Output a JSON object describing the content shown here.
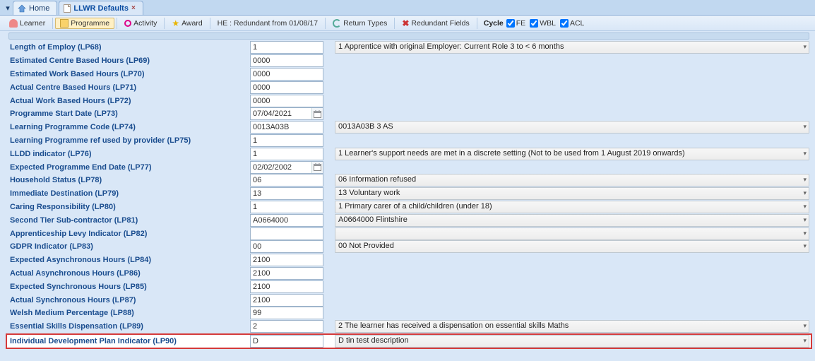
{
  "tabs": {
    "home": "Home",
    "llwr": "LLWR Defaults"
  },
  "toolbar": {
    "learner": "Learner",
    "programme": "Programme",
    "activity": "Activity",
    "award": "Award",
    "he": "HE : Redundant from 01/08/17",
    "return_types": "Return Types",
    "redundant": "Redundant Fields",
    "cycle": "Cycle",
    "fe": "FE",
    "wbl": "WBL",
    "acl": "ACL"
  },
  "rows": [
    {
      "label": "Length of Employ (LP68)",
      "value": "1",
      "desc": "1  Apprentice with original Employer: Current Role 3 to < 6 months",
      "dd": true
    },
    {
      "label": "Estimated Centre Based Hours (LP69)",
      "value": "0000"
    },
    {
      "label": "Estimated Work Based Hours (LP70)",
      "value": "0000"
    },
    {
      "label": "Actual Centre Based Hours (LP71)",
      "value": "0000"
    },
    {
      "label": "Actual Work Based Hours (LP72)",
      "value": "0000"
    },
    {
      "label": "Programme Start Date (LP73)",
      "value": "07/04/2021",
      "cal": true
    },
    {
      "label": "Learning Programme Code (LP74)",
      "value": "0013A03B",
      "desc": "0013A03B  3 AS",
      "dd": true
    },
    {
      "label": "Learning Programme ref used by provider (LP75)",
      "value": "1"
    },
    {
      "label": "LLDD indicator (LP76)",
      "value": "1",
      "desc": "1  Learner's support needs are met in a discrete setting (Not to be used from 1 August 2019 onwards)",
      "dd": true
    },
    {
      "label": "Expected Programme End Date (LP77)",
      "value": "02/02/2002",
      "cal": true
    },
    {
      "label": "Household Status (LP78)",
      "value": "06",
      "desc": "06  Information refused",
      "dd": true
    },
    {
      "label": "Immediate Destination (LP79)",
      "value": "13",
      "desc": "13  Voluntary work",
      "dd": true
    },
    {
      "label": "Caring Responsibility (LP80)",
      "value": "1",
      "desc": "1  Primary carer of a child/children (under 18)",
      "dd": true
    },
    {
      "label": "Second Tier Sub-contractor (LP81)",
      "value": "A0664000",
      "desc": "A0664000  Flintshire",
      "dd": true
    },
    {
      "label": "Apprenticeship Levy Indicator (LP82)",
      "value": "",
      "desc": "",
      "dd": true
    },
    {
      "label": "GDPR Indicator (LP83)",
      "value": "00",
      "desc": "00  Not Provided",
      "dd": true
    },
    {
      "label": "Expected Asynchronous Hours (LP84)",
      "value": "2100"
    },
    {
      "label": "Actual Asynchronous Hours (LP86)",
      "value": "2100"
    },
    {
      "label": "Expected Synchronous Hours (LP85)",
      "value": "2100"
    },
    {
      "label": "Actual Synchronous Hours (LP87)",
      "value": "2100"
    },
    {
      "label": "Welsh Medium Percentage   (LP88)",
      "value": "99"
    },
    {
      "label": "Essential Skills Dispensation (LP89)",
      "value": "2",
      "desc": "2  The learner has received a dispensation on essential skills Maths",
      "dd": true
    },
    {
      "label": "Individual Development Plan Indicator (LP90)",
      "value": "D",
      "desc": "D  tin test description",
      "dd": true,
      "highlight": true
    }
  ]
}
